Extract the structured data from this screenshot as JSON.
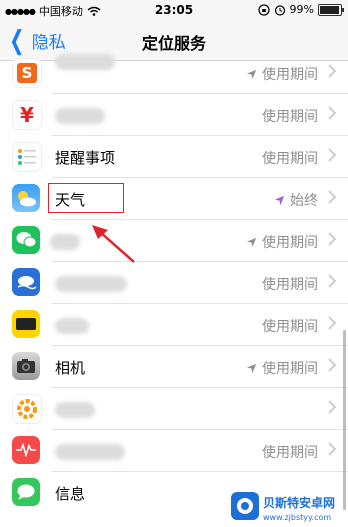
{
  "status_bar": {
    "carrier": "中国移动",
    "time": "23:05",
    "battery": "99%",
    "battery_level": 0.99
  },
  "nav": {
    "back_label": "隐私",
    "title": "定位服务"
  },
  "rows": [
    {
      "name": "",
      "value": "使用期间",
      "arrow": "gray",
      "icon": "orange-s"
    },
    {
      "name": "",
      "value": "使用期间",
      "arrow": "none",
      "icon": "yen"
    },
    {
      "name": "提醒事项",
      "value": "使用期间",
      "arrow": "none",
      "icon": "reminders"
    },
    {
      "name": "天气",
      "value": "始终",
      "arrow": "purple",
      "icon": "weather"
    },
    {
      "name": "",
      "value": "使用期间",
      "arrow": "gray",
      "icon": "wechat"
    },
    {
      "name": "",
      "value": "使用期间",
      "arrow": "none",
      "icon": "cloud-blue"
    },
    {
      "name": "",
      "value": "使用期间",
      "arrow": "none",
      "icon": "yellow-app"
    },
    {
      "name": "相机",
      "value": "使用期间",
      "arrow": "gray",
      "icon": "camera"
    },
    {
      "name": "",
      "value": "",
      "arrow": "none",
      "icon": "orange-gear"
    },
    {
      "name": "",
      "value": "使用期间",
      "arrow": "none",
      "icon": "red-wave"
    },
    {
      "name": "信息",
      "value": "",
      "arrow": "none",
      "icon": "messages"
    }
  ],
  "colors": {
    "accent": "#1a7cf5",
    "highlight": "#e0242c",
    "location_purple": "#9b59e6"
  },
  "watermark": {
    "line1": "贝斯特安卓网",
    "line2": "www.zjbstyy.com"
  }
}
